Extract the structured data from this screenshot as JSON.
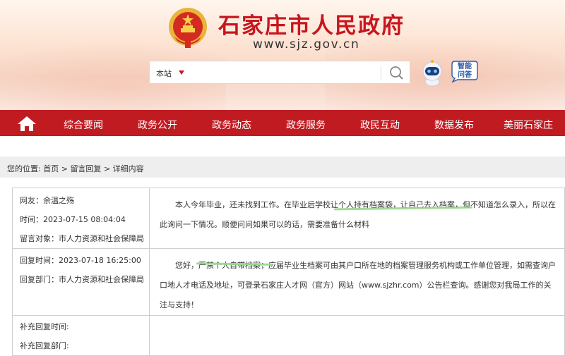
{
  "header": {
    "site_title": "石家庄市人民政府",
    "site_url": "www.sjz.gov.cn",
    "brand_color": "#c8161d",
    "emblem_icon": "national-emblem-icon"
  },
  "search": {
    "scope_label": "本站",
    "placeholder": "",
    "button_icon": "magnifier-icon"
  },
  "assistant": {
    "label_line1": "智能",
    "label_line2": "问答",
    "icon": "robot-icon"
  },
  "nav": {
    "home_icon": "home-icon",
    "items": [
      {
        "label": "综合要闻"
      },
      {
        "label": "政务公开"
      },
      {
        "label": "政务动态"
      },
      {
        "label": "政务服务"
      },
      {
        "label": "政民互动"
      },
      {
        "label": "数据发布"
      },
      {
        "label": "美丽石家庄"
      }
    ]
  },
  "breadcrumb": {
    "prefix": "您的位置:",
    "items": [
      "首页",
      "留言回复",
      "详细内容"
    ],
    "separator": ">"
  },
  "message": {
    "netizen_line": "网友：余温之殇",
    "time_line": "时间：2023-07-15 08:04:04",
    "target_line": "留言对象：市人力资源和社会保障局",
    "content": "本人今年毕业，还未找到工作。在毕业后学校让个人持有档案袋，让自己去入档案，但不知道怎么录入，所以在此询问一下情况。顺便问问如果可以的话，需要准备什么材料"
  },
  "reply": {
    "time_line": "回复时间：2023-07-18 16:25:00",
    "dept_line": "回复部门：市人力资源和社会保障局",
    "content": "您好，严禁个人自带档案；应届毕业生档案可由其户口所在地的档案管理服务机构或工作单位管理，如需查询户口地人才电话及地址，可登录石家庄人才网（官方）网站（www.sjzhr.com）公告栏查询。感谢您对我局工作的关注与支持！"
  },
  "supplement": {
    "time_label": "补充回复时间:",
    "dept_label": "补充回复部门:"
  },
  "highlight_color": "#9bd58d"
}
